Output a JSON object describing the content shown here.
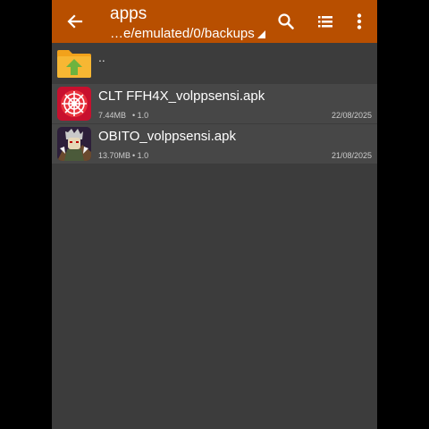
{
  "toolbar": {
    "title": "apps",
    "path": "…e/emulated/0/backups",
    "color": "#b84f00",
    "icons": [
      "back-arrow-icon",
      "search-icon",
      "list-view-icon",
      "more-vert-icon"
    ]
  },
  "up_row": {
    "label": "..",
    "icon": "folder-up-icon"
  },
  "files": [
    {
      "name": "CLT FFH4X_volppsensi.apk",
      "size": "7.44MB",
      "version": "• 1.0",
      "date": "22/08/2025",
      "icon": "app-thumbnail-red"
    },
    {
      "name": "OBITO_volppsensi.apk",
      "size": "13.70MB",
      "version": "• 1.0",
      "date": "21/08/2025",
      "icon": "app-thumbnail-character"
    }
  ]
}
